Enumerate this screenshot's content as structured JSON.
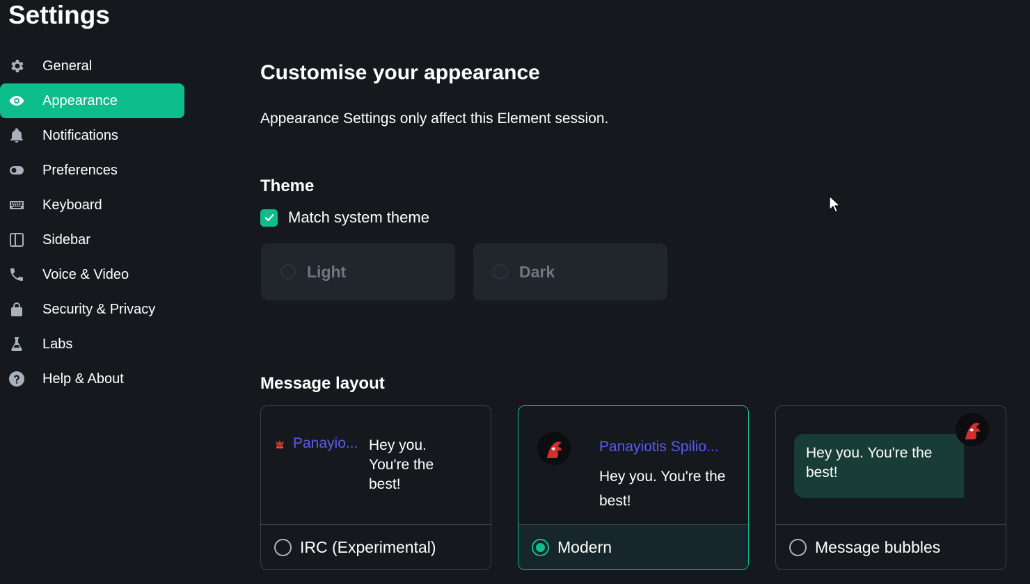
{
  "page_title": "Settings",
  "sidebar": {
    "items": [
      {
        "label": "General",
        "icon": "gear-icon"
      },
      {
        "label": "Appearance",
        "icon": "eye-icon",
        "active": true
      },
      {
        "label": "Notifications",
        "icon": "bell-icon"
      },
      {
        "label": "Preferences",
        "icon": "toggle-icon"
      },
      {
        "label": "Keyboard",
        "icon": "keyboard-icon"
      },
      {
        "label": "Sidebar",
        "icon": "sidebar-panel-icon"
      },
      {
        "label": "Voice & Video",
        "icon": "phone-icon"
      },
      {
        "label": "Security & Privacy",
        "icon": "lock-icon"
      },
      {
        "label": "Labs",
        "icon": "flask-icon"
      },
      {
        "label": "Help & About",
        "icon": "help-icon"
      }
    ]
  },
  "main": {
    "heading": "Customise your appearance",
    "subtext": "Appearance Settings only affect this Element session.",
    "theme": {
      "title": "Theme",
      "match_system_label": "Match system theme",
      "match_system_checked": true,
      "options": [
        {
          "label": "Light",
          "selected": false,
          "disabled": true
        },
        {
          "label": "Dark",
          "selected": false,
          "disabled": true
        }
      ]
    },
    "message_layout": {
      "title": "Message layout",
      "options": [
        {
          "label": "IRC (Experimental)",
          "selected": false,
          "sender": "Panayio...",
          "message": "Hey you. You're the best!"
        },
        {
          "label": "Modern",
          "selected": true,
          "sender": "Panayiotis Spilio...",
          "message": "Hey you. You're the best!"
        },
        {
          "label": "Message bubbles",
          "selected": false,
          "message": "Hey you. You're the best!"
        }
      ]
    }
  },
  "colors": {
    "accent": "#0dbd8b",
    "background": "#15191e",
    "sender_name": "#5b5bf0",
    "bubble": "#173d36"
  }
}
